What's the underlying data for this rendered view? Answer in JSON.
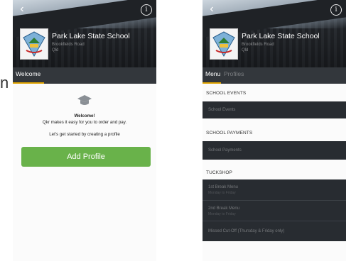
{
  "edge_letter": "n",
  "school": {
    "name": "Park Lake State School",
    "subtitle_1": "Brookfields Road",
    "subtitle_2": "Qld"
  },
  "left_screen": {
    "tab": "Welcome",
    "welcome_title": "Welcome!",
    "welcome_line": "Qkr makes it easy for you to order and pay.",
    "start_line": "Let's get started by creating a profile",
    "add_profile_label": "Add Profile"
  },
  "right_screen": {
    "tabs": [
      "Menu",
      "Profiles"
    ],
    "sections": [
      {
        "title": "SCHOOL EVENTS",
        "items": [
          {
            "label": "School Events",
            "sub": ""
          }
        ]
      },
      {
        "title": "SCHOOL PAYMENTS",
        "items": [
          {
            "label": "School Payments",
            "sub": ""
          }
        ]
      },
      {
        "title": "TUCKSHOP",
        "items": [
          {
            "label": "1st Break Menu",
            "sub": "Monday to Friday"
          },
          {
            "label": "2nd Break Menu",
            "sub": "Monday to Friday"
          },
          {
            "label": "Missed Cut-Off (Thursday & Friday only)",
            "sub": ""
          }
        ]
      }
    ]
  },
  "colors": {
    "add_profile_green": "#69b24a",
    "tab_underline": "#e0a400",
    "dark_row": "#282c31"
  },
  "icons": [
    "back-arrow-icon",
    "info-icon",
    "graduation-cap-icon",
    "school-crest-logo"
  ]
}
